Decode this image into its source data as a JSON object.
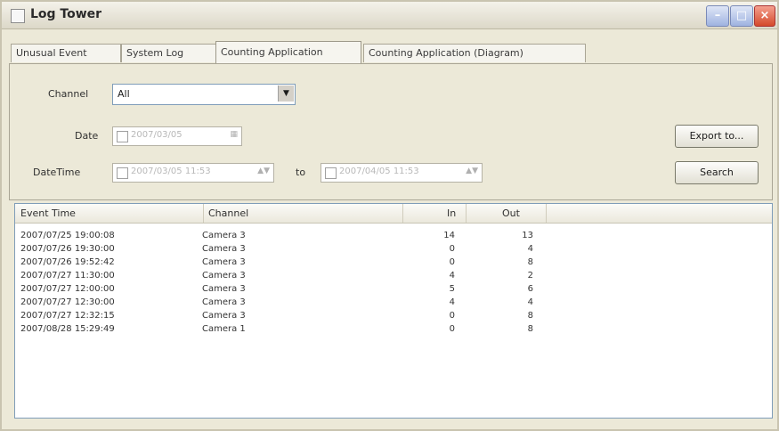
{
  "window": {
    "title": "Log Tower"
  },
  "tabs": [
    {
      "label": "Unusual Event"
    },
    {
      "label": "System Log"
    },
    {
      "label": "Counting Application"
    },
    {
      "label": "Counting Application (Diagram)"
    }
  ],
  "filters": {
    "channel_label": "Channel",
    "channel_value": "All",
    "date_label": "Date",
    "date_value": "2007/03/05",
    "datetime_label": "DateTime",
    "from_value": "2007/03/05 11:53",
    "to_label": "to",
    "to_value": "2007/04/05 11:53"
  },
  "buttons": {
    "export": "Export to...",
    "search": "Search"
  },
  "table": {
    "columns": [
      "Event Time",
      "Channel",
      "In",
      "Out"
    ],
    "rows": [
      {
        "time": "2007/07/25 19:00:08",
        "channel": "Camera 3",
        "in": "14",
        "out": "13"
      },
      {
        "time": "2007/07/26 19:30:00",
        "channel": "Camera 3",
        "in": "0",
        "out": "4"
      },
      {
        "time": "2007/07/26 19:52:42",
        "channel": "Camera 3",
        "in": "0",
        "out": "8"
      },
      {
        "time": "2007/07/27 11:30:00",
        "channel": "Camera 3",
        "in": "4",
        "out": "2"
      },
      {
        "time": "2007/07/27 12:00:00",
        "channel": "Camera 3",
        "in": "5",
        "out": "6"
      },
      {
        "time": "2007/07/27 12:30:00",
        "channel": "Camera 3",
        "in": "4",
        "out": "4"
      },
      {
        "time": "2007/07/27 12:32:15",
        "channel": "Camera 3",
        "in": "0",
        "out": "8"
      },
      {
        "time": "2007/08/28 15:29:49",
        "channel": "Camera 1",
        "in": "0",
        "out": "8"
      }
    ]
  }
}
